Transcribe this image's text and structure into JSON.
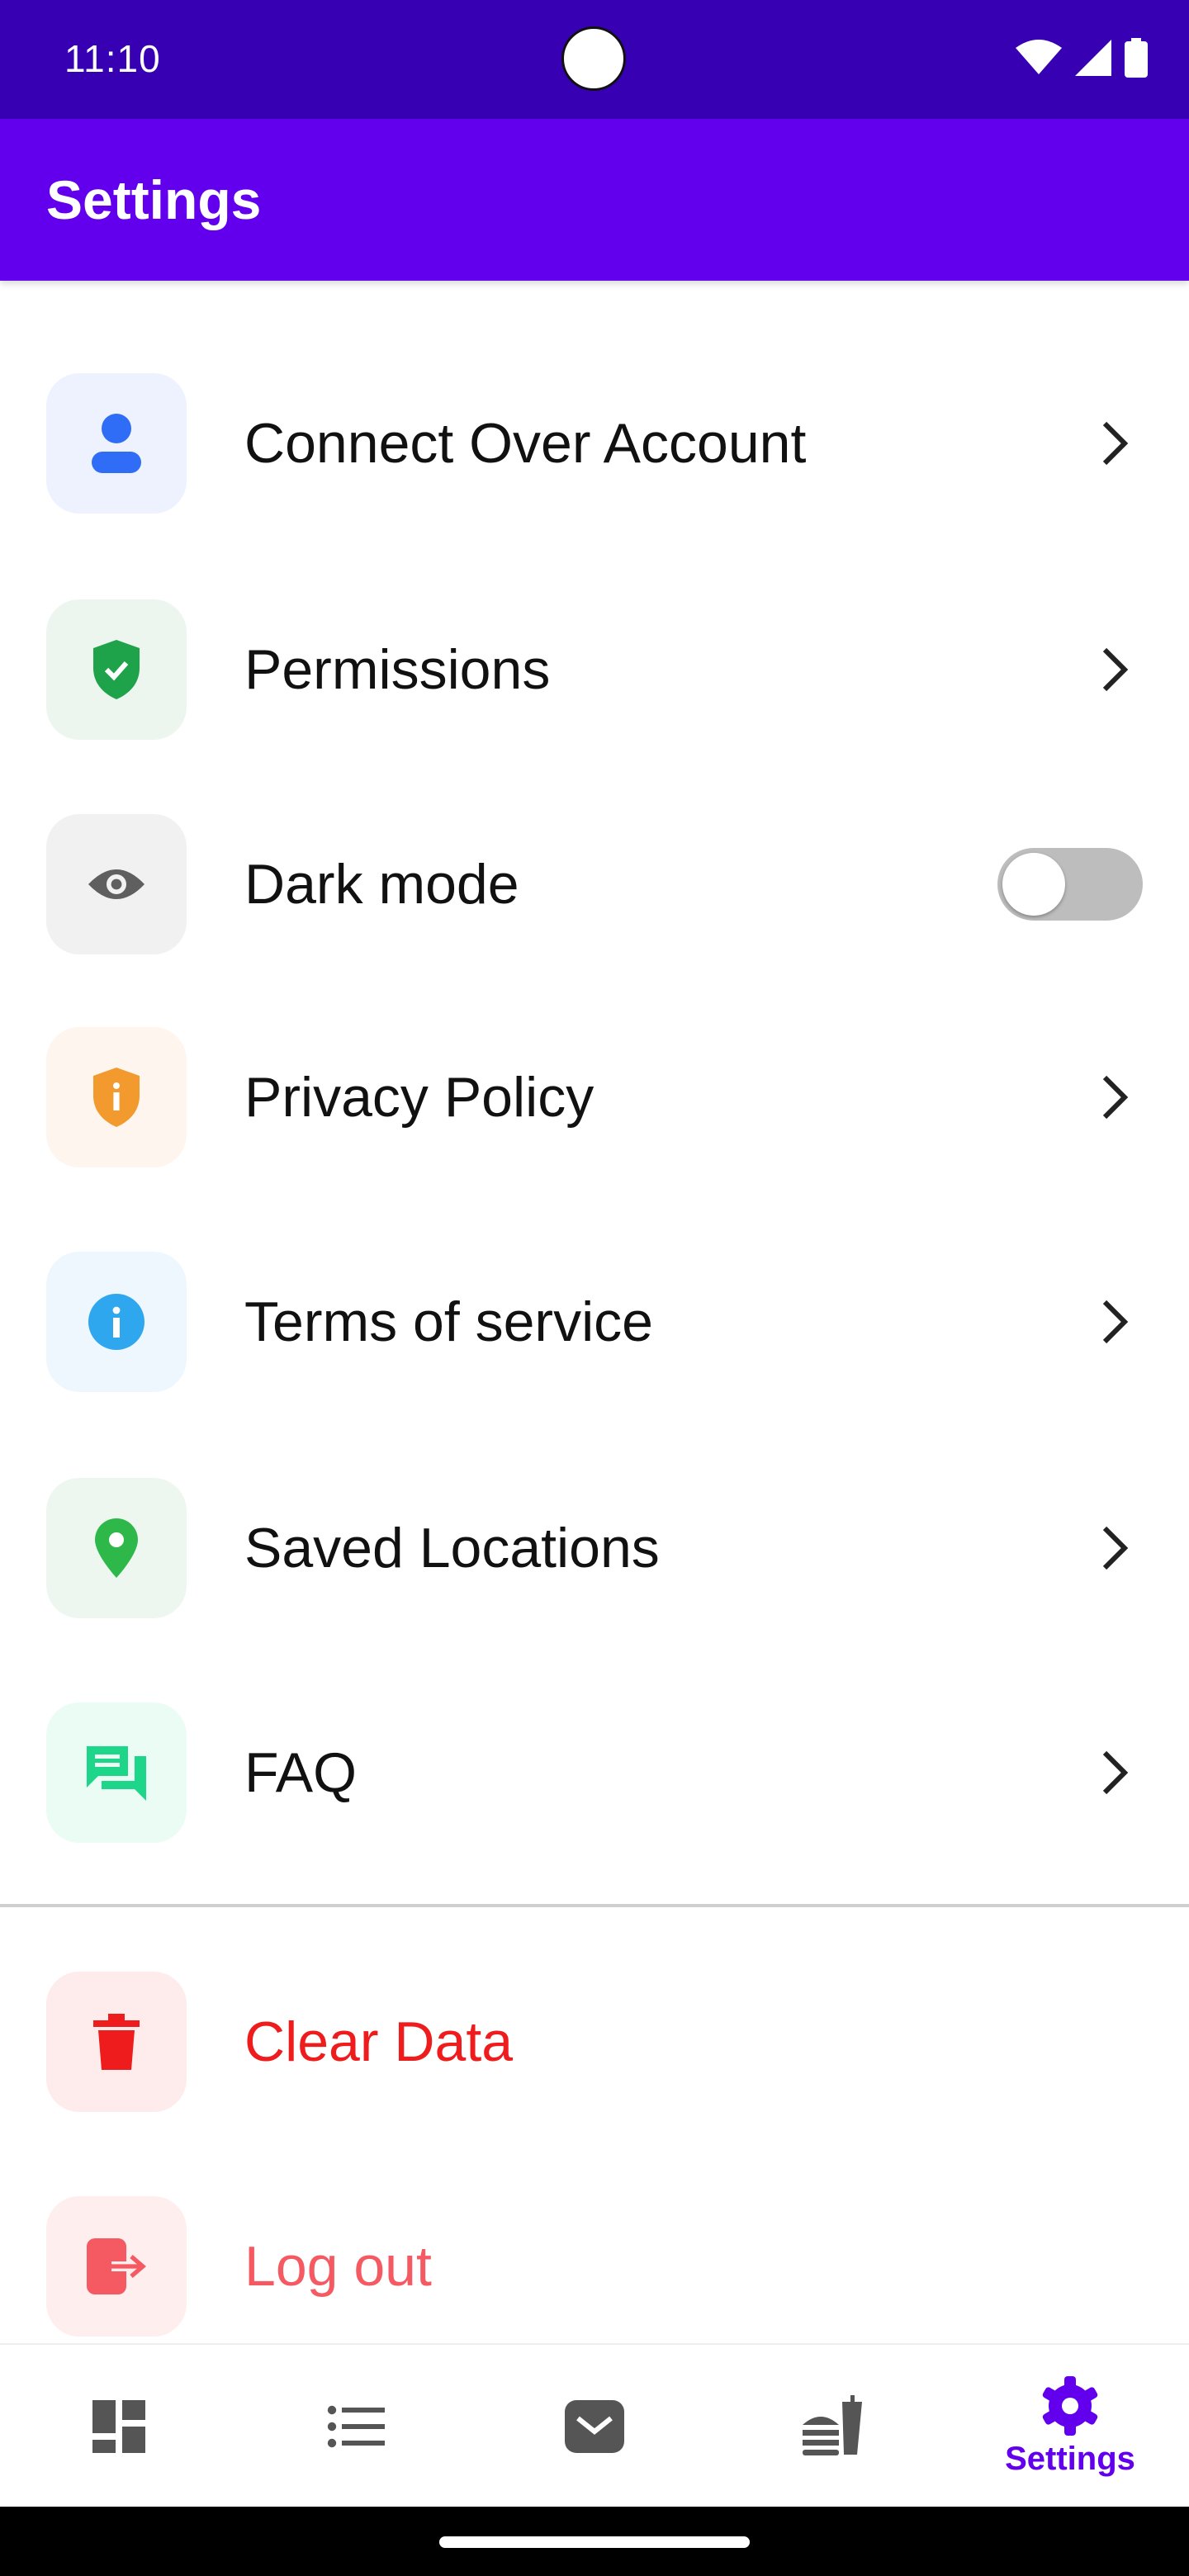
{
  "status_bar": {
    "time": "11:10"
  },
  "app_bar": {
    "title": "Settings"
  },
  "settings": [
    {
      "label": "Connect Over Account",
      "icon": "person-icon",
      "icon_color": "#2f6df6",
      "bg": "#edf2fe",
      "action": "chevron"
    },
    {
      "label": "Permissions",
      "icon": "shield-check-icon",
      "icon_color": "#1fa34a",
      "bg": "#ecf6ef",
      "action": "chevron"
    },
    {
      "label": "Dark mode",
      "icon": "eye-icon",
      "icon_color": "#5f5f5f",
      "bg": "#f1f1f1",
      "action": "toggle",
      "toggle_on": false
    },
    {
      "label": "Privacy Policy",
      "icon": "shield-info-icon",
      "icon_color": "#f29a2e",
      "bg": "#fef5ee",
      "action": "chevron"
    },
    {
      "label": "Terms of service",
      "icon": "info-icon",
      "icon_color": "#2ea7ee",
      "bg": "#eef7fe",
      "action": "chevron"
    },
    {
      "label": "Saved Locations",
      "icon": "location-pin-icon",
      "icon_color": "#2eb84a",
      "bg": "#eef7ef",
      "action": "chevron"
    },
    {
      "label": "FAQ",
      "icon": "chat-icon",
      "icon_color": "#1ed68a",
      "bg": "#ebfcf5",
      "action": "chevron"
    }
  ],
  "danger_actions": [
    {
      "label": "Clear Data",
      "icon": "trash-icon",
      "color": "#ee1c1c",
      "bg": "#feecec"
    },
    {
      "label": "Log out",
      "icon": "logout-icon",
      "color": "#f55a62",
      "bg": "#feeeee"
    }
  ],
  "bottom_nav": {
    "items": [
      {
        "icon": "dashboard-icon"
      },
      {
        "icon": "list-icon"
      },
      {
        "icon": "mail-icon"
      },
      {
        "icon": "fastfood-icon"
      },
      {
        "icon": "gear-icon",
        "label": "Settings",
        "active": true
      }
    ],
    "active_color": "#6200ee",
    "inactive_color": "#555555"
  }
}
